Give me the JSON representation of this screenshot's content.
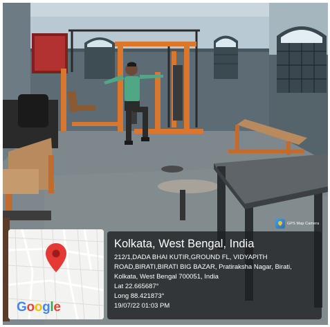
{
  "app_badge": {
    "name": "GPS Map Camera"
  },
  "map": {
    "logo_letters": [
      "G",
      "o",
      "o",
      "g",
      "l",
      "e"
    ],
    "pin_color": "#e53935"
  },
  "location": {
    "title": "Kolkata, West Bengal, India",
    "address_line1": "212/1,DADA BHAI KUTIR,GROUND FL, VIDYAPITH",
    "address_line2": "ROAD,BIRATI,BIRATI BIG BAZAR, Pratiraksha Nagar, Birati,",
    "address_line3": "Kolkata, West Bengal 700051, India",
    "latitude": "Lat 22.665687°",
    "longitude": "Long 88.421873°",
    "datetime": "19/07/22 01:03 PM"
  }
}
